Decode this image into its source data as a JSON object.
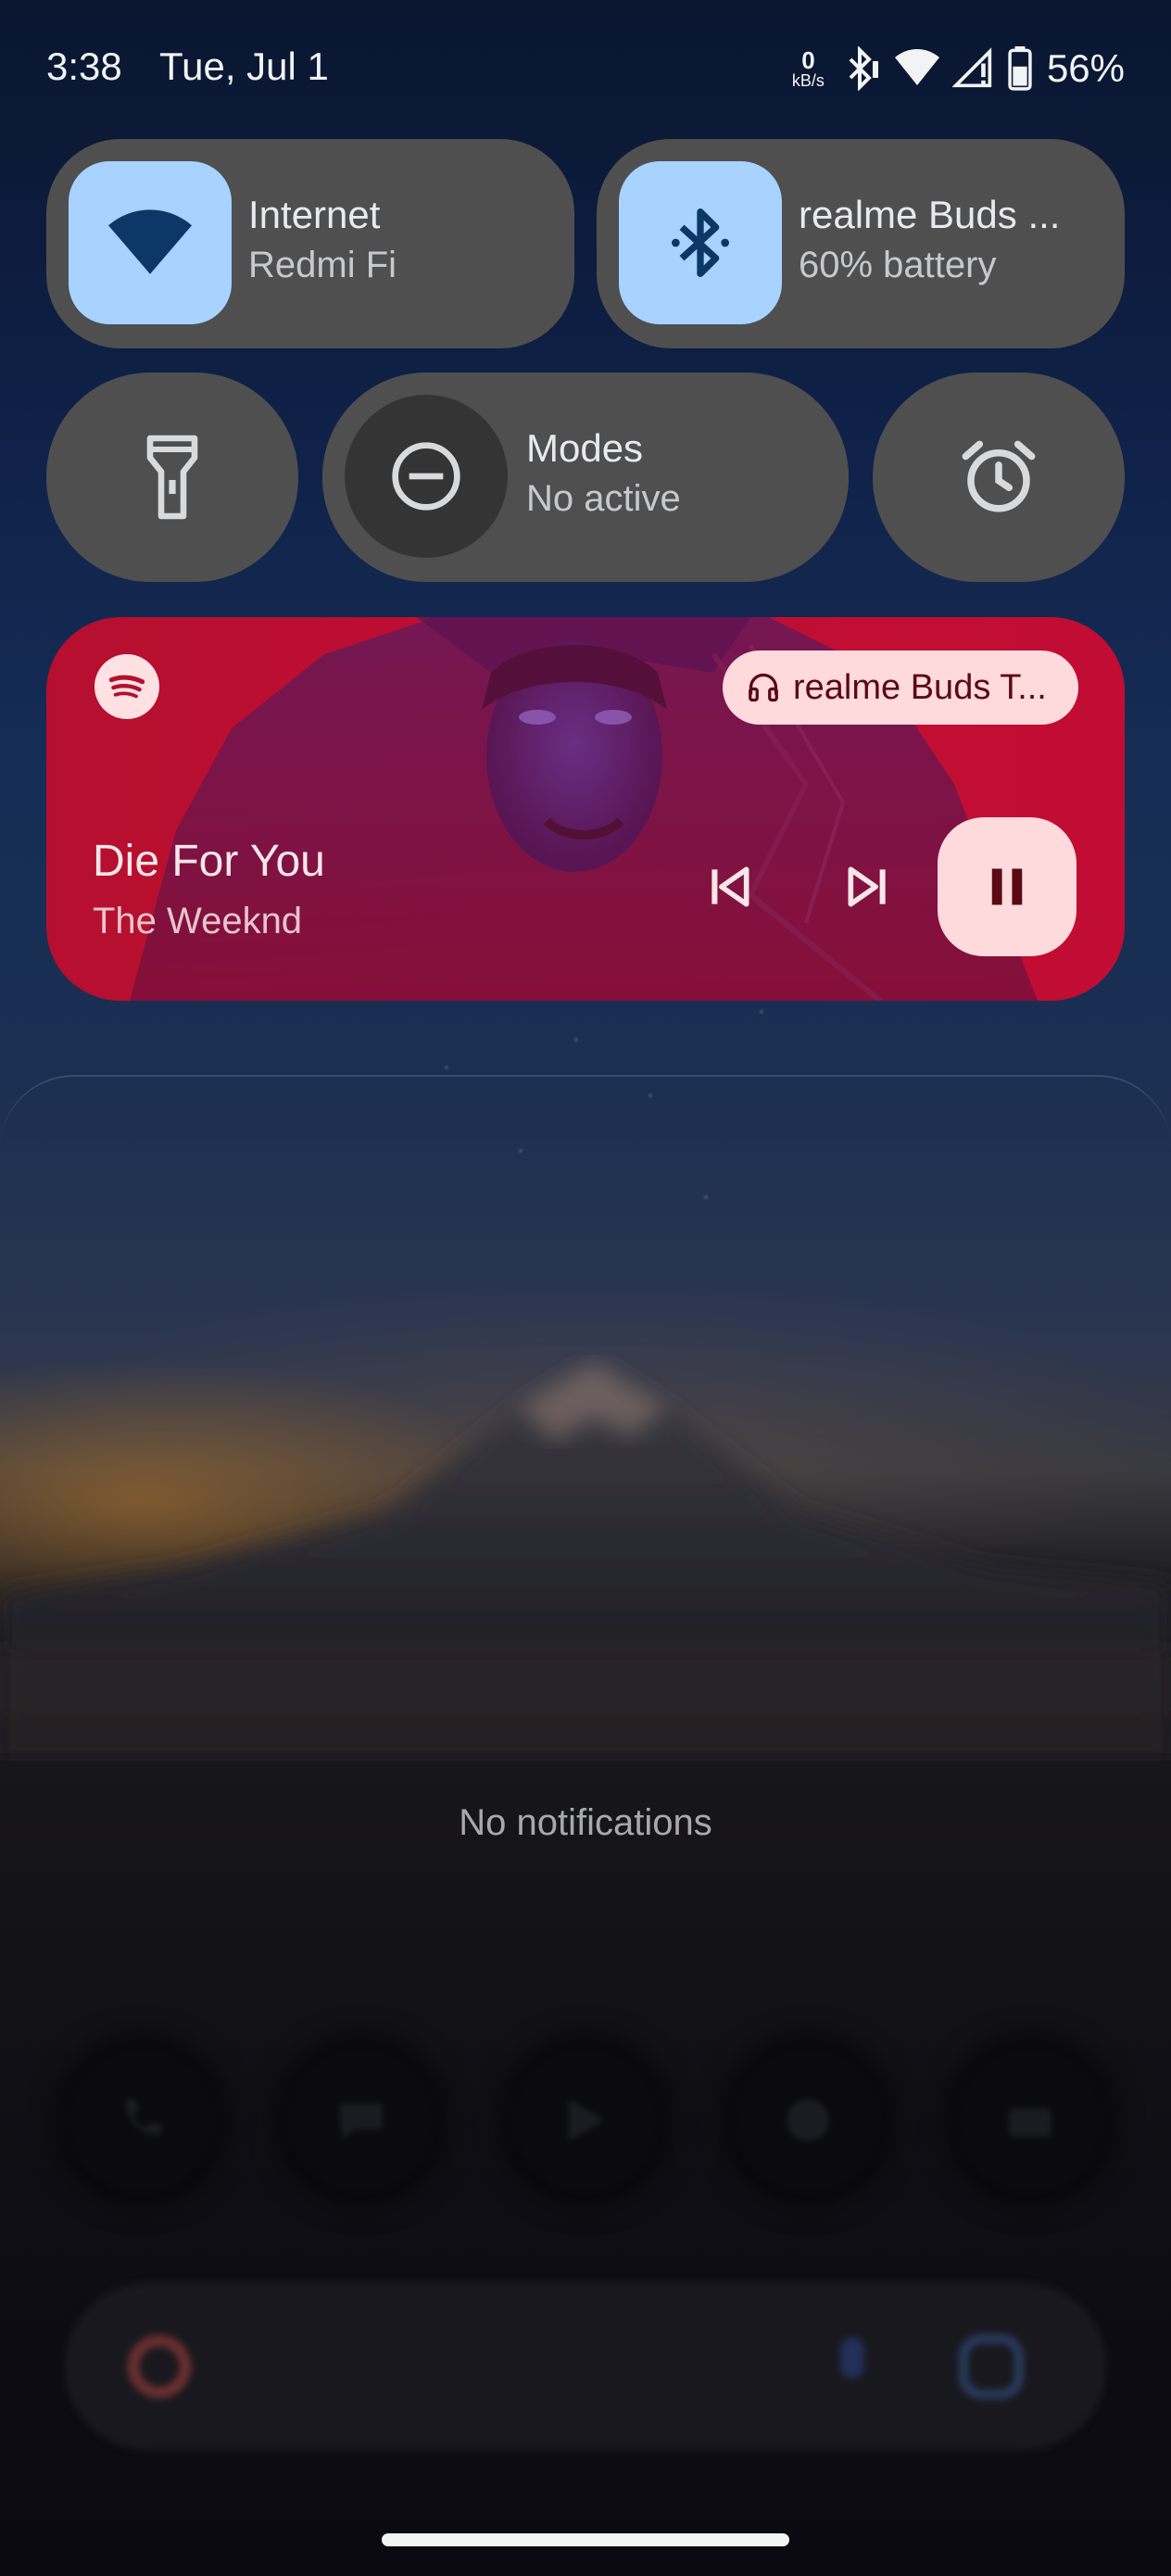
{
  "status_bar": {
    "time": "3:38",
    "date": "Tue, Jul 1",
    "net_speed_value": "0",
    "net_speed_unit": "kB/s",
    "battery_percent": "56%"
  },
  "quick_settings": {
    "internet": {
      "title": "Internet",
      "subtitle": "Redmi Fi",
      "icon": "wifi-icon"
    },
    "bluetooth": {
      "title": "realme Buds ...",
      "subtitle": "60% battery",
      "icon": "bluetooth-icon"
    },
    "flashlight": {
      "icon": "flashlight-icon"
    },
    "modes": {
      "title": "Modes",
      "subtitle": "No active",
      "icon": "do-not-disturb-icon"
    },
    "alarm": {
      "icon": "alarm-icon"
    },
    "colors": {
      "tile_bg": "#4f4f4f",
      "active_icon_bg": "#a8d2ff",
      "active_icon_fg": "#0b3866"
    }
  },
  "media_player": {
    "app_icon": "spotify-icon",
    "output_device": "realme Buds T...",
    "song_title": "Die For You",
    "artist": "The Weeknd",
    "accent": "#c10f33",
    "button_bg": "#ffdadd"
  },
  "notifications": {
    "empty_text": "No notifications"
  }
}
